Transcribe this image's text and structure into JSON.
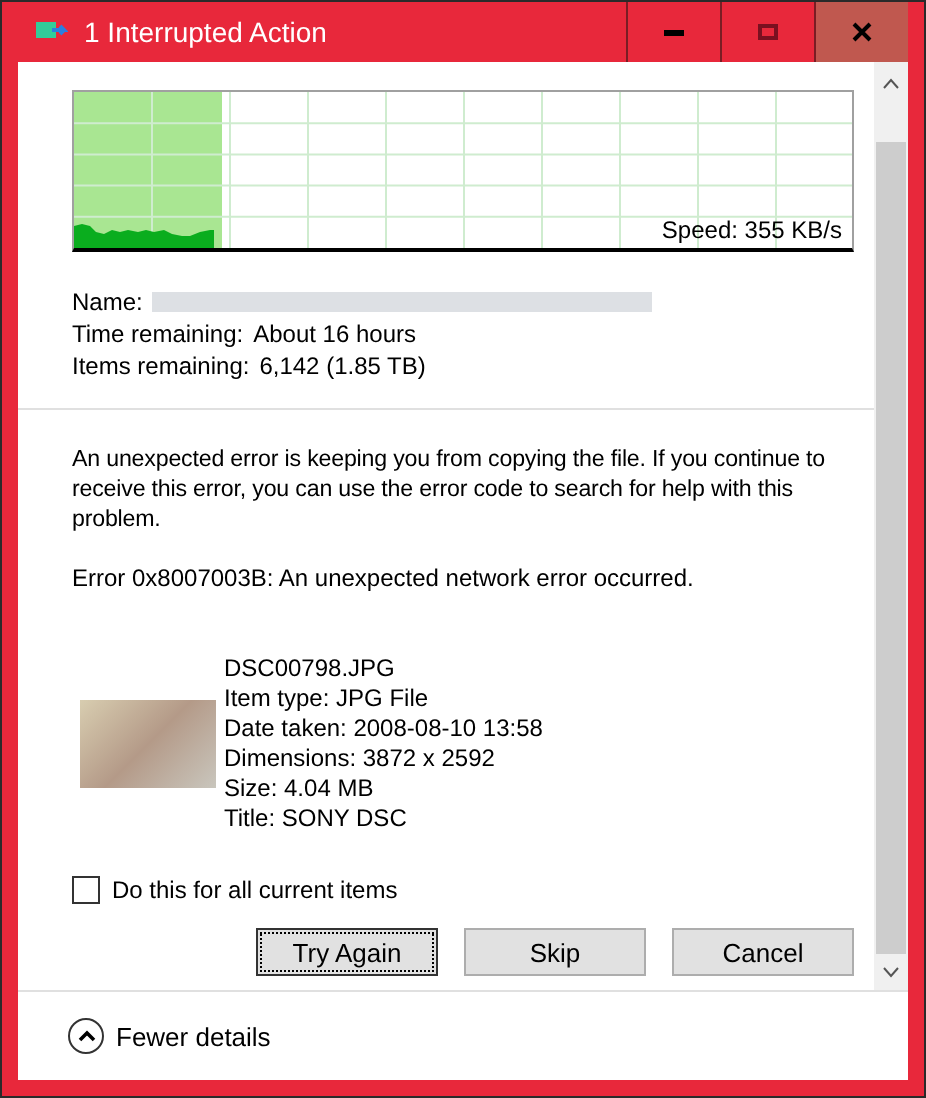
{
  "window": {
    "title": "1 Interrupted Action"
  },
  "transfer": {
    "progress": {
      "level": 0.19
    },
    "speed": "Speed: 355 KB/s",
    "details": [
      {
        "label": "Name:",
        "kind": "blurred"
      },
      {
        "label": "Time remaining:",
        "value": "About 16 hours",
        "kind": "text"
      },
      {
        "label": "Items remaining:",
        "value": "6,142 (1.85 TB)",
        "kind": "text"
      }
    ]
  },
  "error": {
    "message": "An unexpected error is keeping you from copying the file. If you continue to receive this error, you can use the error code to search for help with this problem.",
    "code": "Error 0x8007003B: An unexpected network error occurred."
  },
  "file": {
    "lines": [
      "DSC00798.JPG",
      "Item type: JPG File",
      "Date taken: 2008-08-10 13:58",
      "Dimensions: 3872 x 2592",
      "Size: 4.04 MB",
      "Title: SONY DSC"
    ]
  },
  "apply_all": {
    "label": "Do this for all current items",
    "checked": false
  },
  "buttons": [
    {
      "label": "Try Again",
      "selected": true
    },
    {
      "label": "Skip",
      "selected": false
    },
    {
      "label": "Cancel",
      "selected": false
    }
  ],
  "footer": {
    "label": "Fewer details",
    "expanded": true
  }
}
